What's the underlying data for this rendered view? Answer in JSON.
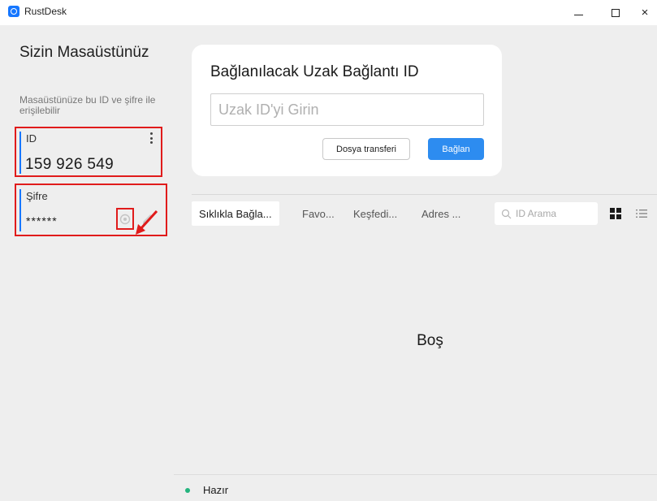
{
  "window": {
    "title": "RustDesk",
    "controls": {
      "minimize": "–",
      "maximize": "□",
      "close": "×"
    }
  },
  "sidebar": {
    "title": "Sizin Masaüstünüz",
    "subtitle": "Masaüstünüze bu ID ve şifre ile erişilebilir",
    "id_label": "ID",
    "id_value": "159 926 549",
    "password_label": "Şifre",
    "password_value": "******"
  },
  "connect_card": {
    "title": "Bağlanılacak Uzak Bağlantı ID",
    "input_placeholder": "Uzak ID'yi Girin",
    "input_value": "",
    "transfer_button": "Dosya transferi",
    "connect_button": "Bağlan"
  },
  "tabs": [
    {
      "label": "Sıklıkla Bağla...",
      "active": true
    },
    {
      "label": "Favo...",
      "active": false
    },
    {
      "label": "Keşfedi...",
      "active": false
    },
    {
      "label": "Adres ...",
      "active": false
    }
  ],
  "search": {
    "placeholder": "ID Arama"
  },
  "empty_state": "Boş",
  "status": {
    "text": "Hazır",
    "color": "#24b47e"
  },
  "colors": {
    "accent": "#2d8cf0",
    "highlight_annotation": "#e01b1b",
    "panel_bg": "#eeeeee"
  },
  "icons": [
    "app-logo-icon",
    "kebab-menu-icon",
    "eye-icon",
    "pencil-icon",
    "search-icon",
    "grid-view-icon",
    "list-view-icon",
    "annotation-arrow-icon"
  ]
}
